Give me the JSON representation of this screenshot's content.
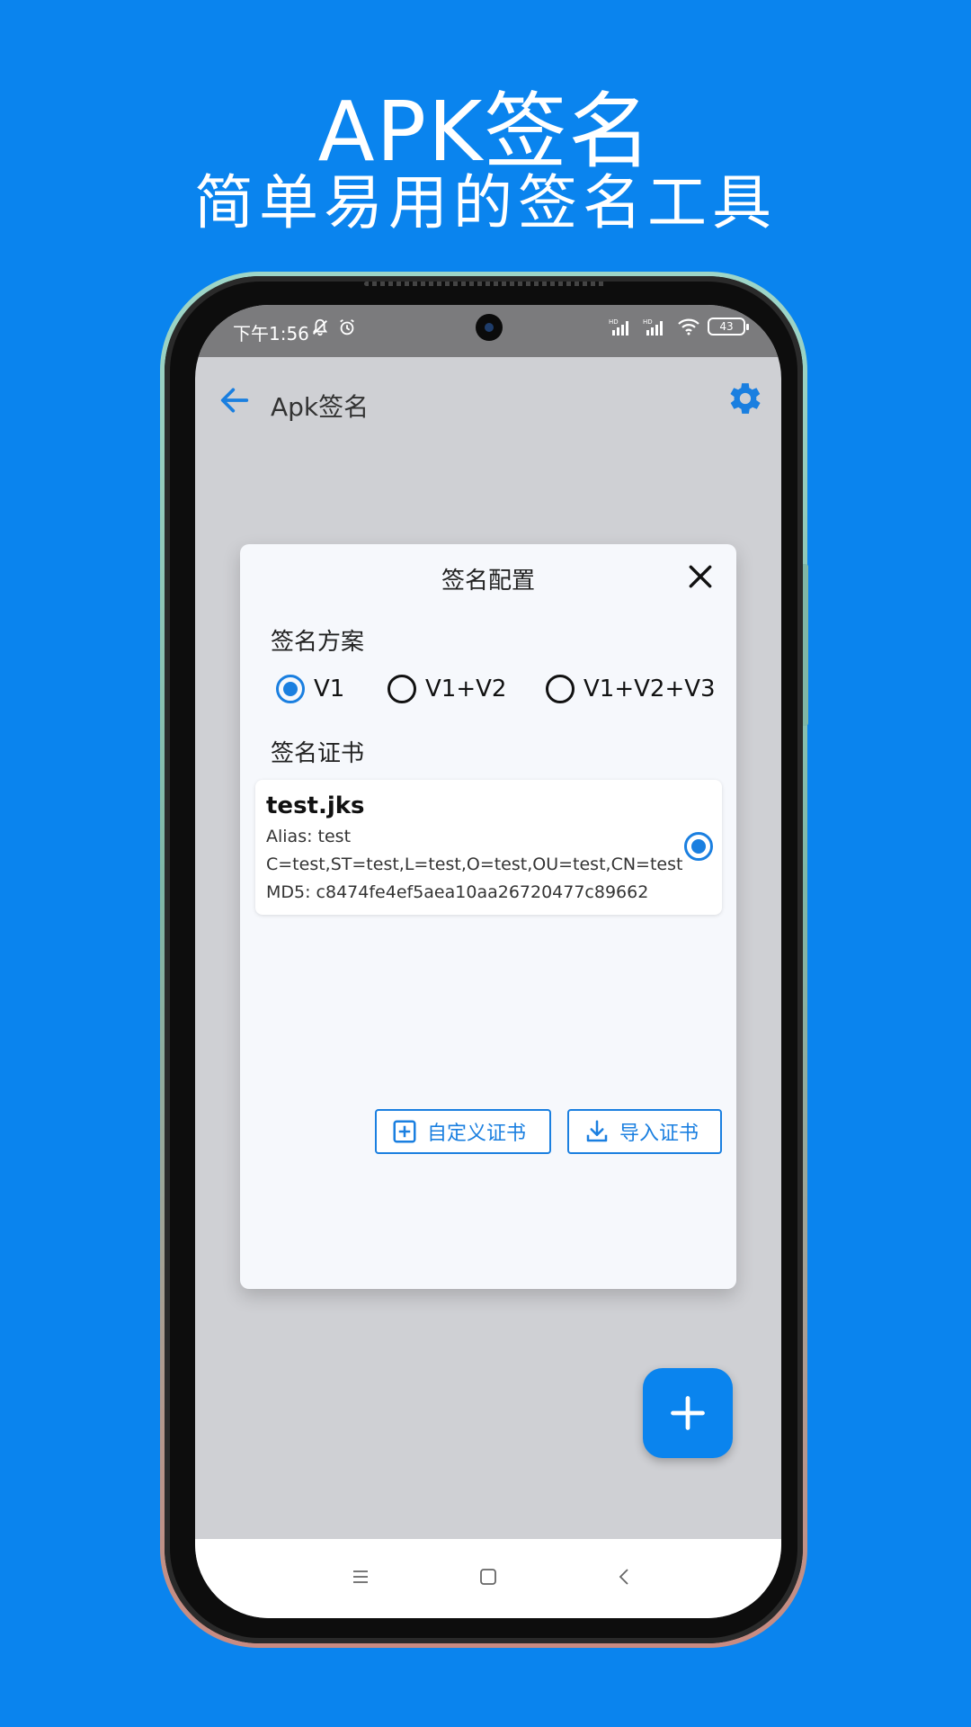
{
  "hero": {
    "title": "APK签名",
    "subtitle": "简单易用的签名工具"
  },
  "status_bar": {
    "time": "下午1:56",
    "battery": "43"
  },
  "app_bar": {
    "title": "Apk签名"
  },
  "dialog": {
    "title": "签名配置",
    "scheme_label": "签名方案",
    "schemes": [
      {
        "label": "V1",
        "selected": true
      },
      {
        "label": "V1+V2",
        "selected": false
      },
      {
        "label": "V1+V2+V3",
        "selected": false
      }
    ],
    "cert_label": "签名证书",
    "certificate": {
      "name": "test.jks",
      "alias": "Alias: test",
      "dn": "C=test,ST=test,L=test,O=test,OU=test,CN=test",
      "md5": "MD5: c8474fe4ef5aea10aa26720477c89662",
      "selected": true
    },
    "custom_cert_label": "自定义证书",
    "import_cert_label": "导入证书"
  },
  "colors": {
    "background": "#0a84ee",
    "accent": "#1a7fe0"
  },
  "icons": {
    "back": "arrow-left-icon",
    "settings": "gear-icon",
    "close": "close-icon",
    "add_box": "plus-box-icon",
    "download": "download-icon",
    "fab": "plus-icon"
  }
}
